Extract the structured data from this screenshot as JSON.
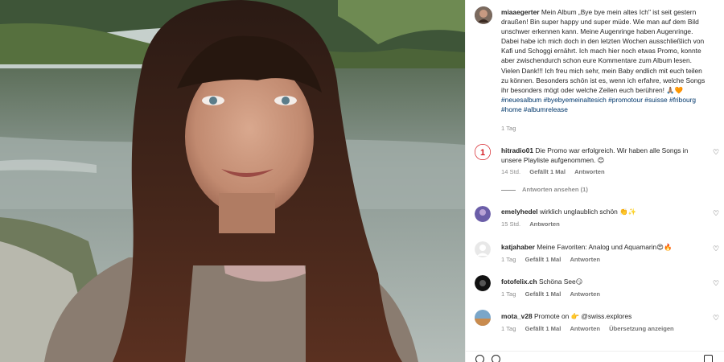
{
  "post": {
    "username": "miaaegerter",
    "caption": "Mein Album „Bye bye mein altes Ich\" ist seit gestern draußen! Bin super happy und super müde. Wie man auf dem Bild unschwer erkennen kann. Meine Augenringe haben Augenringe. Dabei habe ich mich doch in den letzten Wochen ausschließlich von Kafi und Schoggi ernährt. Ich mach hier noch etwas Promo, konnte aber zwischendurch schon eure Kommentare zum Album lesen. Vielen Dank!!! Ich freu mich sehr, mein Baby endlich mit euch teilen zu können. Besonders schön ist es, wenn ich erfahre, welche Songs ihr besonders mögt oder welche Zeilen euch berühren! 🙏🏽🧡",
    "hashtags": "#neuesalbum #byebyemeinaltesich #promotour #suisse #fribourg #home #albumrelease",
    "time": "1 Tag"
  },
  "comments": [
    {
      "username": "hitradio01",
      "text": "Die Promo war erfolgreich. Wir haben alle Songs in unsere Playliste aufgenommen. 😊",
      "time": "14 Std.",
      "likes": "Gefällt 1 Mal",
      "reply": "Antworten",
      "avatar_color": "#d4191f"
    },
    {
      "username": "emelyhedel",
      "text": "wirklich unglaublich schön 👏✨",
      "time": "15 Std.",
      "likes": "",
      "reply": "Antworten",
      "avatar_color": "#6b5ea8"
    },
    {
      "username": "katjahaber",
      "text": "Meine Favoriten: Analog und Aquamarin😍🔥",
      "time": "1 Tag",
      "likes": "Gefällt 1 Mal",
      "reply": "Antworten",
      "avatar_color": "#dbdbdb"
    },
    {
      "username": "fotofelix.ch",
      "text": "Schöna See😏",
      "time": "1 Tag",
      "likes": "Gefällt 1 Mal",
      "reply": "Antworten",
      "avatar_color": "#111111"
    },
    {
      "username": "mota_v28",
      "text": "Promote on 👉 @swiss.explores",
      "time": "1 Tag",
      "likes": "Gefällt 1 Mal",
      "reply": "Antworten",
      "translate": "Übersetzung anzeigen",
      "avatar_color": "#c98b4e"
    }
  ],
  "replies_toggle": "Antworten ansehen (1)",
  "icons": {
    "like": "heart-icon",
    "comment": "comment-icon",
    "share": "share-icon"
  }
}
